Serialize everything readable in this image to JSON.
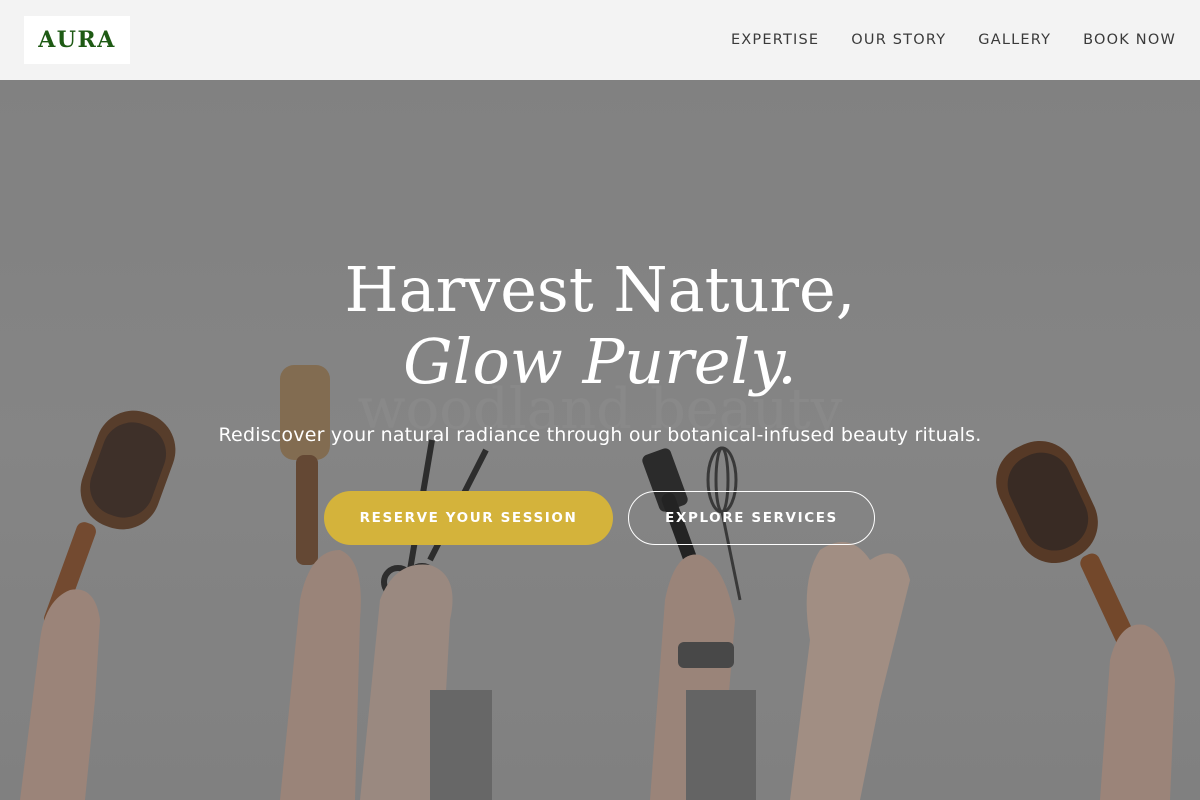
{
  "brand": {
    "logo_text": "AURA",
    "logo_color": "#1e5a14"
  },
  "nav": {
    "items": [
      {
        "label": "EXPERTISE"
      },
      {
        "label": "OUR STORY"
      },
      {
        "label": "GALLERY"
      },
      {
        "label": "BOOK NOW"
      }
    ]
  },
  "hero": {
    "headline_line1": "Harvest Nature,",
    "headline_line2": "Glow Purely.",
    "subtext": "Rediscover your natural radiance through our botanical-infused beauty rituals.",
    "primary_button": "RESERVE YOUR SESSION",
    "secondary_button": "EXPLORE SERVICES",
    "image_icon": "hands-holding-hair-tools-photo",
    "accent_color": "#d4b33b"
  }
}
